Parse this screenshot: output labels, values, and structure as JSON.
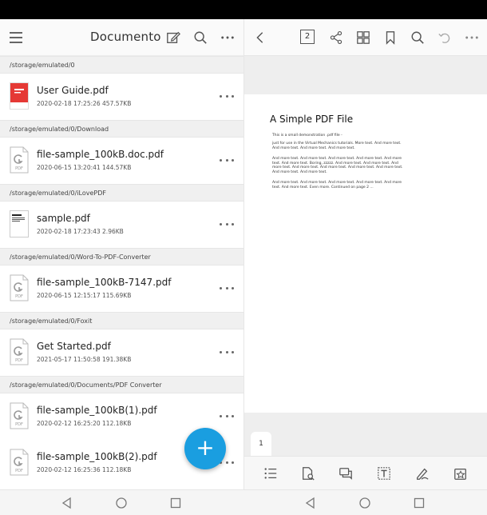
{
  "left": {
    "title": "Documento",
    "icons": [
      "menu-icon",
      "edit-icon",
      "search-icon",
      "more-icon"
    ],
    "sections": [
      {
        "path": "/storage/emulated/0",
        "files": [
          {
            "name": "User Guide.pdf",
            "meta": "2020-02-18 17:25:26 457.57KB",
            "thumb": "red"
          }
        ]
      },
      {
        "path": "/storage/emulated/0/Download",
        "files": [
          {
            "name": "file-sample_100kB.doc.pdf",
            "meta": "2020-06-15 13:20:41 144.57KB",
            "thumb": "pdf"
          }
        ]
      },
      {
        "path": "/storage/emulated/0/iLovePDF",
        "files": [
          {
            "name": "sample.pdf",
            "meta": "2020-02-18 17:23:43 2.96KB",
            "thumb": "doc"
          }
        ]
      },
      {
        "path": "/storage/emulated/0/Word-To-PDF-Converter",
        "files": [
          {
            "name": "file-sample_100kB-7147.pdf",
            "meta": "2020-06-15 12:15:17 115.69KB",
            "thumb": "pdf"
          }
        ]
      },
      {
        "path": "/storage/emulated/0/Foxit",
        "files": [
          {
            "name": "Get Started.pdf",
            "meta": "2021-05-17 11:50:58 191.38KB",
            "thumb": "pdf"
          }
        ]
      },
      {
        "path": "/storage/emulated/0/Documents/PDF Converter",
        "files": [
          {
            "name": "file-sample_100kB(1).pdf",
            "meta": "2020-02-12 16:25:20 112.18KB",
            "thumb": "pdf"
          },
          {
            "name": "file-sample_100kB(2).pdf",
            "meta": "2020-02-12 16:25:36 112.18KB",
            "thumb": "pdf"
          }
        ]
      }
    ],
    "fab_label": "+"
  },
  "right": {
    "page_number": "2",
    "page_tab": "1",
    "pdf": {
      "title": "A Simple PDF File",
      "paragraphs": [
        "This is a small demonstration .pdf file -",
        "just for use in the Virtual Mechanics tutorials. More text. And more text. And more text. And more text. And more text.",
        "And more text. And more text. And more text. And more text. And more text. And more text. Boring, zzzzz. And more text. And more text. And more text. And more text. And more text. And more text. And more text. And more text. And more text.",
        "And more text. And more text. And more text. And more text. And more text. And more text. Even more. Continued on page 2 ..."
      ]
    }
  },
  "colors": {
    "accent": "#1a9ee0",
    "pdf_red": "#e53935"
  },
  "pdf_thumb_text": "PDF"
}
